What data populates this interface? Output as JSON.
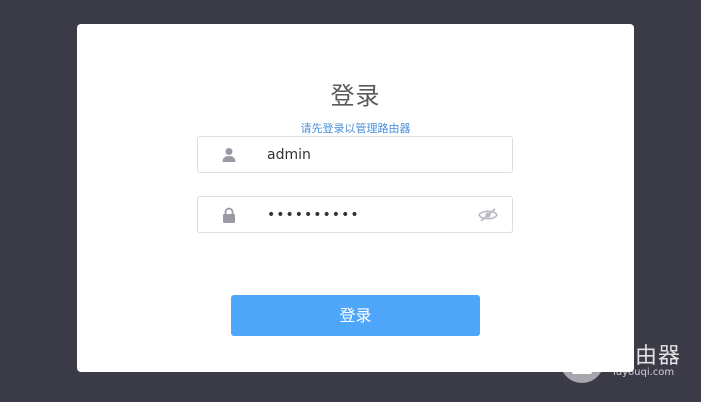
{
  "login": {
    "title": "登录",
    "subtitle": "请先登录以管理路由器",
    "username_value": "admin",
    "password_value": "••••••••••",
    "submit_label": "登录"
  },
  "icons": {
    "username": "user-icon",
    "password": "lock-icon",
    "toggle_password": "eye-slash-icon"
  },
  "watermark": {
    "title": "路由器",
    "url": "luyouqi.com"
  },
  "colors": {
    "background": "#3b3b47",
    "card": "#ffffff",
    "accent": "#4ea6fb",
    "subtitle": "#4a8fd8"
  }
}
